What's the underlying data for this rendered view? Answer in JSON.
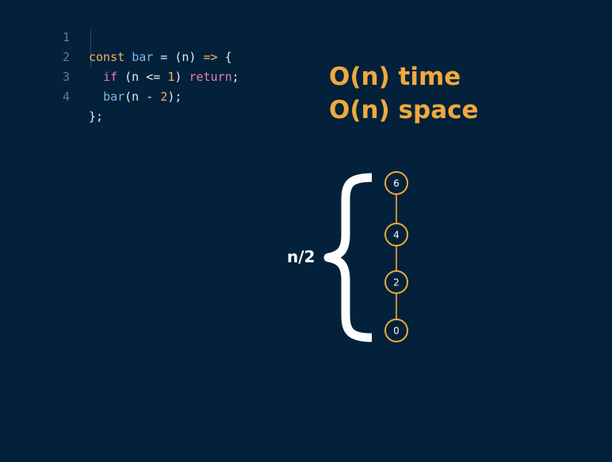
{
  "code": {
    "lines": [
      {
        "number": "1",
        "tokens": [
          {
            "text": "const ",
            "kind": "kw"
          },
          {
            "text": "bar",
            "kind": "fn"
          },
          {
            "text": " = (n) ",
            "kind": "plain"
          },
          {
            "text": "=>",
            "kind": "kw"
          },
          {
            "text": " {",
            "kind": "plain"
          }
        ]
      },
      {
        "number": "2",
        "tokens": [
          {
            "text": "  ",
            "kind": "plain"
          },
          {
            "text": "if",
            "kind": "ret"
          },
          {
            "text": " (n <= ",
            "kind": "plain"
          },
          {
            "text": "1",
            "kind": "num"
          },
          {
            "text": ") ",
            "kind": "plain"
          },
          {
            "text": "return",
            "kind": "ret"
          },
          {
            "text": ";",
            "kind": "plain"
          }
        ]
      },
      {
        "number": "3",
        "tokens": [
          {
            "text": "  ",
            "kind": "plain"
          },
          {
            "text": "bar",
            "kind": "fn"
          },
          {
            "text": "(n - ",
            "kind": "plain"
          },
          {
            "text": "2",
            "kind": "num"
          },
          {
            "text": ");",
            "kind": "plain"
          }
        ]
      },
      {
        "number": "4",
        "tokens": [
          {
            "text": "};",
            "kind": "plain"
          }
        ]
      }
    ]
  },
  "complexity": {
    "time": "O(n) time",
    "space": "O(n) space"
  },
  "diagram": {
    "brace_label": "n/2",
    "nodes": [
      "6",
      "4",
      "2",
      "0"
    ]
  },
  "colors": {
    "background": "#03213a",
    "accent": "#efa93e",
    "node_stroke": "#efa93e",
    "brace": "#ffffff"
  }
}
